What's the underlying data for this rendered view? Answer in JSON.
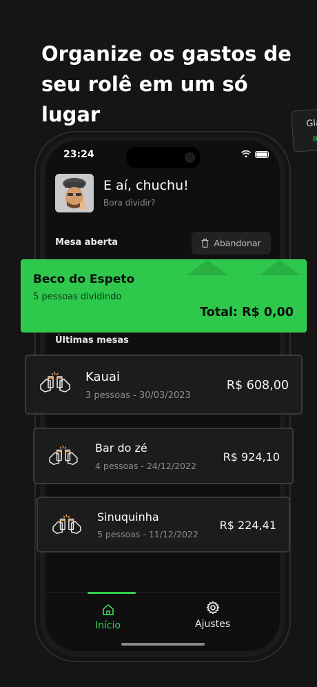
{
  "headline": "Organize os gastos de seu rolê em um só lugar",
  "peek_card": {
    "title": "Gla",
    "subtitle": "R"
  },
  "status_bar": {
    "time": "23:24"
  },
  "greeting": {
    "title": "E aí, chuchu!",
    "subtitle": "Bora dividir?"
  },
  "open_table": {
    "section_label": "Mesa aberta",
    "abandon_label": "Abandonar",
    "name": "Beco do Espeto",
    "people": "5 pessoas dividindo",
    "total": "Total: R$ 0,00"
  },
  "recent_tables": {
    "section_label": "Últimas mesas",
    "items": [
      {
        "name": "Kauai",
        "meta": "3 pessoas - 30/03/2023",
        "amount": "R$ 608,00"
      },
      {
        "name": "Bar do zé",
        "meta": "4 pessoas - 24/12/2022",
        "amount": "R$ 924,10"
      },
      {
        "name": "Sinuquinha",
        "meta": "5 pessoas - 11/12/2022",
        "amount": "R$ 224,41"
      }
    ]
  },
  "nav": {
    "home_label": "Início",
    "settings_label": "Ajustes",
    "active_color": "#2fd24f"
  },
  "colors": {
    "accent": "#2dc84c",
    "background": "#151515"
  }
}
